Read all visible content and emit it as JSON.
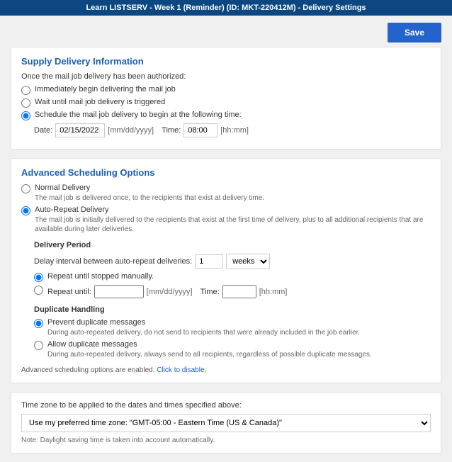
{
  "header": {
    "title": "Learn LISTSERV - Week 1 (Reminder) (ID: MKT-220412M) - Delivery Settings"
  },
  "actions": {
    "save": "Save"
  },
  "supply": {
    "heading": "Supply Delivery Information",
    "intro": "Once the mail job delivery has been authorized:",
    "opts": {
      "immediate": "Immediately begin delivering the mail job",
      "wait": "Wait until mail job delivery is triggered",
      "schedule": "Schedule the mail job delivery to begin at the following time:"
    },
    "date_label": "Date:",
    "date_value": "02/15/2022",
    "date_hint": "[mm/dd/yyyy]",
    "time_label": "Time:",
    "time_value": "08:00",
    "time_hint": "[hh:mm]"
  },
  "advanced": {
    "heading": "Advanced Scheduling Options",
    "normal": {
      "label": "Normal Delivery",
      "desc": "The mail job is delivered once, to the recipients that exist at delivery time."
    },
    "auto": {
      "label": "Auto-Repeat Delivery",
      "desc": "The mail job is initially delivered to the recipients that exist at the first time of delivery, plus to all additional recipients that are available during later deliveries."
    },
    "period": {
      "heading": "Delivery Period",
      "delay_label": "Delay interval between auto-repeat deliveries:",
      "delay_value": "1",
      "delay_unit": "weeks",
      "repeat_stop": "Repeat until stopped manually.",
      "repeat_until": "Repeat until:",
      "date_value": "",
      "date_hint": "[mm/dd/yyyy]",
      "time_label": "Time:",
      "time_value": "",
      "time_hint": "[hh:mm]"
    },
    "dup": {
      "heading": "Duplicate Handling",
      "prevent": "Prevent duplicate messages",
      "prevent_desc": "During auto-repeated delivery, do not send to recipients that were already included in the job earlier.",
      "allow": "Allow duplicate messages",
      "allow_desc": "During auto-repeated delivery, always send to all recipients, regardless of possible duplicate messages."
    },
    "footer_text": "Advanced scheduling options are enabled. ",
    "footer_link": "Click to disable."
  },
  "tz": {
    "label": "Time zone to be applied to the dates and times specified above:",
    "selected": "Use my preferred time zone: \"GMT-05:00 - Eastern Time (US & Canada)\"",
    "note": "Note: Daylight saving time is taken into account automatically."
  }
}
